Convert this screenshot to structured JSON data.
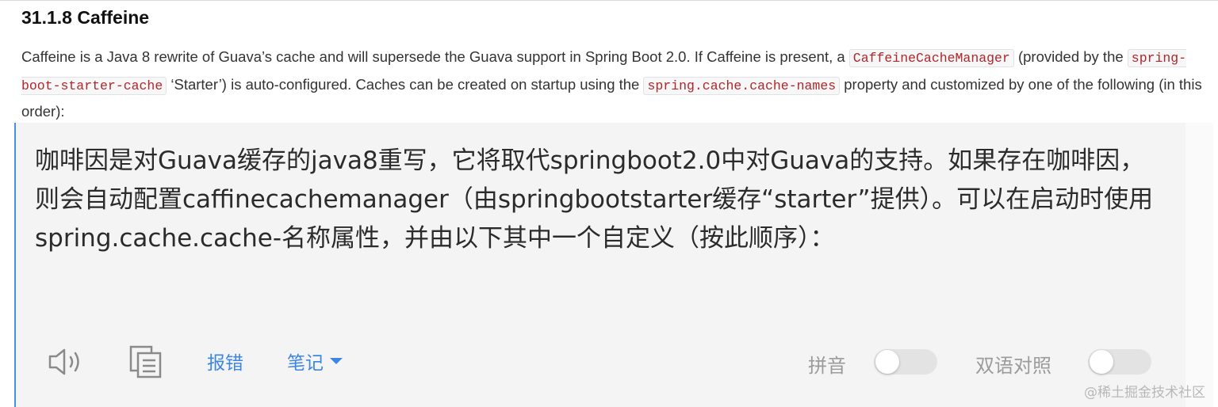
{
  "doc": {
    "heading": "31.1.8 Caffeine",
    "paragraph": {
      "t1": "Caffeine is a Java 8 rewrite of Guava’s cache and will supersede the Guava support in Spring Boot 2.0. If Caffeine is present, a ",
      "code1": "CaffeineCacheManager",
      "t2": " (provided by the ",
      "code2": "spring-boot-starter-cache",
      "t3": " ‘Starter’) is auto-configured. Caches can be created on startup using the ",
      "code3": "spring.cache.cache-names",
      "t4": " property and customized by one of the following (in this order):"
    }
  },
  "translation": {
    "text": "咖啡因是对Guava缓存的java8重写，它将取代springboot2.0中对Guava的支持。如果存在咖啡因，则会自动配置caffinecachemanager（由springbootstarter缓存“starter”提供）。可以在启动时使用spring.cache.cache-名称属性，并由以下其中一个自定义（按此顺序）："
  },
  "toolbar": {
    "speaker_icon": "speaker-icon",
    "copy_icon": "copy-icon",
    "report_label": "报错",
    "notes_label": "笔记",
    "pinyin_label": "拼音",
    "pinyin_on": false,
    "bilingual_label": "双语对照",
    "bilingual_on": false
  },
  "watermark": "@稀土掘金技术社区",
  "colors": {
    "link_blue": "#3e86e3",
    "panel_bg": "#f4f4f4",
    "panel_border": "#4a8fe6",
    "code_text": "#b0262a"
  }
}
